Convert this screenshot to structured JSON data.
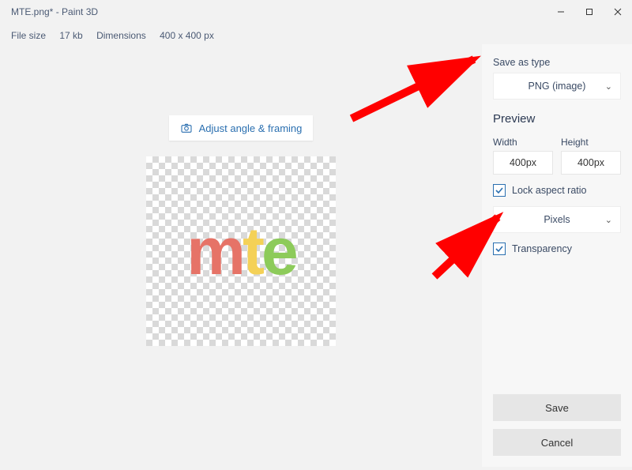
{
  "title": "MTE.png* - Paint 3D",
  "fileinfo": {
    "size_label": "File size",
    "size_value": "17 kb",
    "dim_label": "Dimensions",
    "dim_value": "400 x 400 px"
  },
  "adjust_label": "Adjust angle & framing",
  "sidebar": {
    "save_as_type_label": "Save as type",
    "format": "PNG (image)",
    "preview_label": "Preview",
    "width_label": "Width",
    "height_label": "Height",
    "width_value": "400px",
    "height_value": "400px",
    "lock_label": "Lock aspect ratio",
    "units": "Pixels",
    "transparency_label": "Transparency",
    "save_label": "Save",
    "cancel_label": "Cancel"
  },
  "logo": {
    "m": "m",
    "t": "t",
    "e": "e"
  }
}
